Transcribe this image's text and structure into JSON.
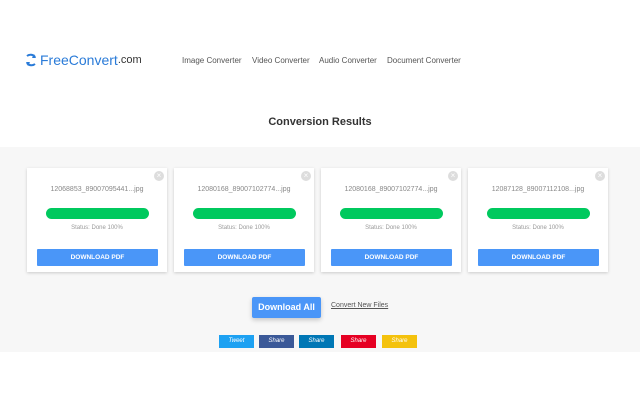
{
  "header": {
    "logo_brand": "FreeConvert",
    "logo_suffix": ".com",
    "nav": [
      "Image Converter",
      "Video Converter",
      "Audio Converter",
      "Document Converter"
    ]
  },
  "title": "Conversion Results",
  "files": [
    {
      "name": "12068853_89007095441...jpg",
      "status": "Status: Done 100%",
      "button": "DOWNLOAD PDF",
      "progress": 100
    },
    {
      "name": "12080168_89007102774...jpg",
      "status": "Status: Done 100%",
      "button": "DOWNLOAD PDF",
      "progress": 100
    },
    {
      "name": "12080168_89007102774...jpg",
      "status": "Status: Done 100%",
      "button": "DOWNLOAD PDF",
      "progress": 100
    },
    {
      "name": "12087128_89007112108...jpg",
      "status": "Status: Done 100%",
      "button": "DOWNLOAD PDF",
      "progress": 100
    }
  ],
  "actions": {
    "download_all": "Download All",
    "convert_new": "Convert New Files"
  },
  "share": [
    {
      "label": "Tweet",
      "color": "#1da1f2"
    },
    {
      "label": "Share",
      "color": "#3b5998"
    },
    {
      "label": "Share",
      "color": "#0077b5"
    },
    {
      "label": "Share",
      "color": "#e60023"
    },
    {
      "label": "Share",
      "color": "#f4c20d"
    }
  ]
}
